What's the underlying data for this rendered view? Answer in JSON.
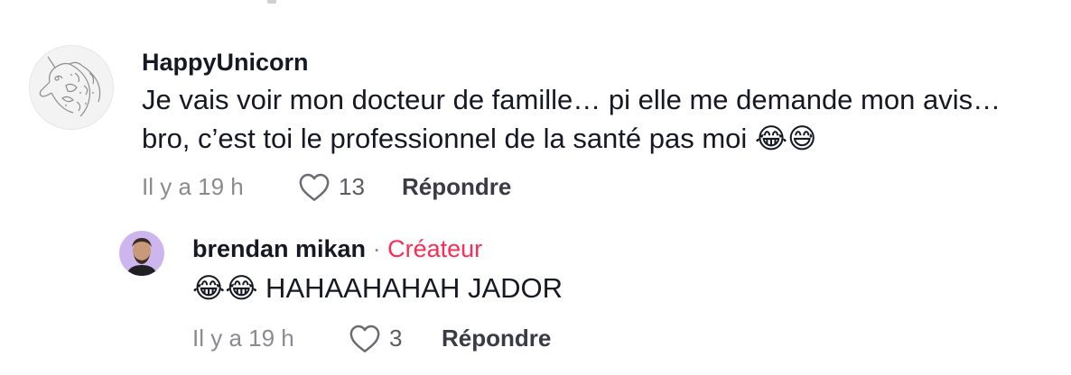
{
  "comments": [
    {
      "username": "HappyUnicorn",
      "text_line1": "Je vais voir mon docteur de famille… pi elle me demande mon avis…",
      "text_line2": "bro, c’est toi le professionnel de la santé pas moi 😂😅",
      "time": "Il y a 19 h",
      "likes": "13",
      "reply_label": "Répondre"
    }
  ],
  "reply": {
    "username": "brendan mikan",
    "separator": "·",
    "badge": "Créateur",
    "text": "😂😂 HAHAAHAHAH JADOR",
    "time": "Il y a 19 h",
    "likes": "3",
    "reply_label": "Répondre"
  },
  "colors": {
    "creator_badge": "#fe2c55",
    "muted": "#8a8b91"
  },
  "icons": {
    "like": "heart-outline-icon"
  }
}
